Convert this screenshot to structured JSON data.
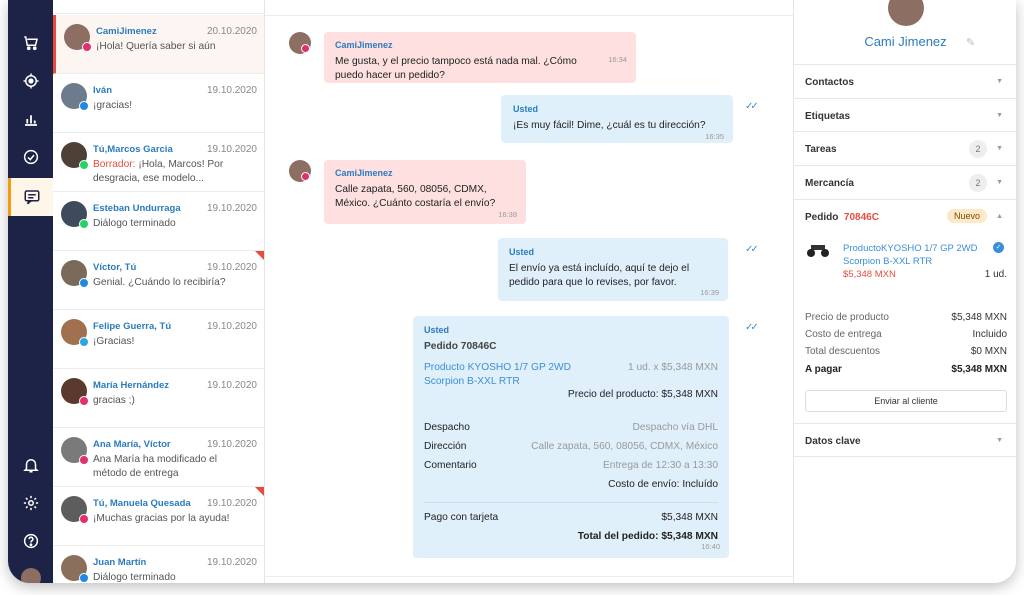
{
  "nav": {
    "items": [
      {
        "icon": "cart-icon"
      },
      {
        "icon": "target-icon"
      },
      {
        "icon": "chart-icon"
      },
      {
        "icon": "check-circle-icon"
      },
      {
        "icon": "chat-icon",
        "active": true
      }
    ],
    "bottom": [
      {
        "icon": "bell-icon"
      },
      {
        "icon": "gear-icon"
      },
      {
        "icon": "help-icon"
      }
    ]
  },
  "conversations": [
    {
      "name": "CamiJimenez",
      "date": "20.10.2020",
      "preview": "¡Hola! Quería saber si aún",
      "channel": "instagram",
      "active": true,
      "avatar_color": "#8d6e63"
    },
    {
      "name": "Iván",
      "date": "19.10.2020",
      "preview": "¡gracias!",
      "channel": "messenger",
      "avatar_color": "#6d7b8d"
    },
    {
      "name": "Tú,Marcos Garcia",
      "date": "19.10.2020",
      "draft_label": "Borrador:",
      "preview": "¡Hola, Marcos! Por desgracia, ese modelo...",
      "channel": "whatsapp",
      "avatar_color": "#4e4037"
    },
    {
      "name": "Esteban Undurraga",
      "date": "19.10.2020",
      "preview": "Diálogo terminado",
      "channel": "whatsapp",
      "avatar_color": "#3d4b5c"
    },
    {
      "name": "Víctor, Tú",
      "date": "19.10.2020",
      "preview": "Genial. ¿Cuándo lo recibiría?",
      "channel": "messenger",
      "flag": true,
      "avatar_color": "#7b6a5a"
    },
    {
      "name": "Felipe Guerra, Tú",
      "date": "19.10.2020",
      "preview": "¡Gracias!",
      "channel": "telegram",
      "avatar_color": "#a0704f"
    },
    {
      "name": "María Hernández",
      "date": "19.10.2020",
      "preview": "gracias ;)",
      "channel": "instagram",
      "avatar_color": "#5a3a2e"
    },
    {
      "name": "Ana María, Víctor",
      "date": "19.10.2020",
      "preview": "Ana María ha modificado el método de entrega",
      "channel": "instagram",
      "avatar_color": "#7a7a7a"
    },
    {
      "name": "Tú, Manuela Quesada",
      "date": "19.10.2020",
      "preview": "¡Muchas gracias por la ayuda!",
      "channel": "instagram",
      "flag": true,
      "avatar_color": "#5d5d5d"
    },
    {
      "name": "Juan Martín",
      "date": "19.10.2020",
      "preview": "Diálogo terminado",
      "channel": "messenger",
      "avatar_color": "#8a6f5c"
    }
  ],
  "chat": {
    "messages": [
      {
        "author": "CamiJimenez",
        "text": "Me gusta, y el precio tampoco está nada mal. ¿Cómo puedo hacer un pedido?",
        "time": "16:34"
      },
      {
        "author": "Usted",
        "text": "¡Es muy fácil! Dime, ¿cuál es tu dirección?",
        "time": "16:35"
      },
      {
        "author": "CamiJimenez",
        "text": "Calle zapata, 560, 08056, CDMX, México. ¿Cuánto costaría el envío?",
        "time": "16:38"
      },
      {
        "author": "Usted",
        "text": "El envío ya está incluído, aquí te dejo el pedido para que lo revises, por favor.",
        "time": "16:39"
      }
    ],
    "order": {
      "author": "Usted",
      "title": "Pedido 70846C",
      "product": "Producto KYOSHO 1/7 GP 2WD Scorpion B-XXL RTR",
      "qty_price": "1 ud. x $5,348 MXN",
      "product_price": "Precio del producto: $5,348 MXN",
      "shipping_label": "Despacho",
      "shipping_value": "Despacho vía DHL",
      "address_label": "Dirección",
      "address_value": "Calle zapata, 560, 08056, CDMX, México",
      "comment_label": "Comentario",
      "comment_value": "Entrega de 12:30 a 13:30",
      "shipping_cost": "Costo de envío: Incluído",
      "payment_label": "Pago con tarjeta",
      "payment_value": "$5,348 MXN",
      "total": "Total del pedido: $5,348 MXN",
      "time": "16:40"
    }
  },
  "panel": {
    "contact_name": "Cami Jimenez",
    "sections": {
      "contacts": "Contactos",
      "tags": "Etiquetas",
      "tasks": "Tareas",
      "tasks_count": "2",
      "goods": "Mercancía",
      "goods_count": "2",
      "order_label": "Pedido",
      "order_code": "70846C",
      "order_status": "Nuevo",
      "key_data": "Datos clave"
    },
    "product": {
      "name": "ProductoKYOSHO 1/7 GP 2WD Scorpion B-XXL RTR",
      "price": "$5,348 MXN",
      "qty": "1 ud."
    },
    "totals": {
      "product_price_label": "Precio de producto",
      "product_price_value": "$5,348 MXN",
      "delivery_label": "Costo de entrega",
      "delivery_value": "Incluido",
      "discount_label": "Total descuentos",
      "discount_value": "$0 MXN",
      "pay_label": "A pagar",
      "pay_value": "$5,348 MXN"
    },
    "send_button": "Enviar al cliente"
  },
  "colors": {
    "nav_bg": "#1d2347",
    "accent_blue": "#2a7bbf",
    "incoming_bubble": "#fde0df",
    "outgoing_bubble": "#e0f0fb",
    "alert_red": "#e74c3c",
    "active_orange": "#f39c12"
  }
}
